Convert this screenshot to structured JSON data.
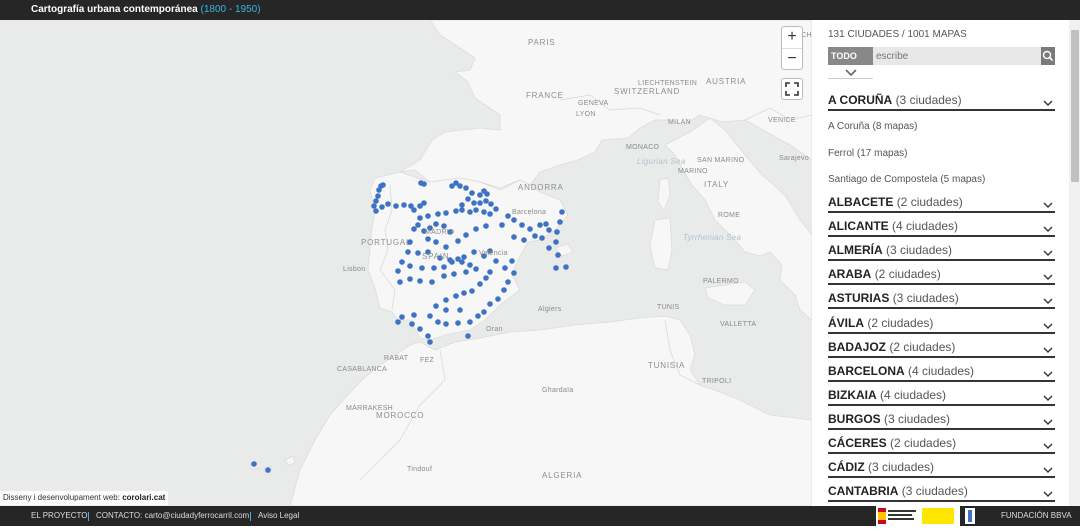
{
  "header": {
    "title": "Cartografía urbana contemporánea",
    "years": "(1800 - 1950)"
  },
  "map": {
    "controls": {
      "zoom_in": "+",
      "zoom_out": "−"
    },
    "credit_text": "Disseny i desenvolupament web:",
    "credit_link": "corolari.cat",
    "labels": {
      "paris": "PARIS",
      "munich": "MUNICH",
      "france": "FRANCE",
      "liechtenstein": "LIECHTENSTEIN",
      "austria": "AUSTRIA",
      "geneva": "GENEVA",
      "switzerland": "SWITZERLAND",
      "lyon": "LYON",
      "milan": "MILAN",
      "venice": "VENICE",
      "sanmarino": "SAN MARINO",
      "monaco": "MONACO",
      "ligurian": "Ligurian Sea",
      "italy": "ITALY",
      "andorra": "ANDORRA",
      "sarajevo": "Sarajevo",
      "rome": "ROME",
      "barcelona": "Barcelona",
      "madrid": "MADRID",
      "portugal": "PORTUGAL",
      "spain": "SPAIN",
      "tyrrhenian": "Tyrrhenian Sea",
      "valencia": "Valencia",
      "lisbon": "Lisbon",
      "palermo": "PALERMO",
      "algiers": "Algiers",
      "tunis": "TUNIS",
      "oran": "Oran",
      "valletta": "VALLETTA",
      "rabat": "RABAT",
      "fez": "FEZ",
      "casablanca": "CASABLANCA",
      "tunisia": "TUNISIA",
      "marrakesh": "MARRAKESH",
      "tripoli": "TRIPOLI",
      "morocco": "MOROCCO",
      "ghardaia": "Ghardaïa",
      "algeria": "ALGERIA",
      "tindouf": "Tindouf"
    },
    "city_points": 143
  },
  "panel": {
    "counts": "131 CIUDADES / 1001 MAPAS",
    "filter_all": "TODO",
    "search_placeholder": "escribe",
    "provinces": [
      {
        "name": "A CORUÑA",
        "count": "(3 ciudades)"
      },
      {
        "name": "ALBACETE",
        "count": "(2 ciudades)"
      },
      {
        "name": "ALICANTE",
        "count": "(4 ciudades)"
      },
      {
        "name": "ALMERÍA",
        "count": "(3 ciudades)"
      },
      {
        "name": "ARABA",
        "count": "(2 ciudades)"
      },
      {
        "name": "ASTURIAS",
        "count": "(3 ciudades)"
      },
      {
        "name": "ÁVILA",
        "count": "(2 ciudades)"
      },
      {
        "name": "BADAJOZ",
        "count": "(2 ciudades)"
      },
      {
        "name": "BARCELONA",
        "count": "(4 ciudades)"
      },
      {
        "name": "BIZKAIA",
        "count": "(4 ciudades)"
      },
      {
        "name": "BURGOS",
        "count": "(3 ciudades)"
      },
      {
        "name": "CÁCERES",
        "count": "(2 ciudades)"
      },
      {
        "name": "CÁDIZ",
        "count": "(3 ciudades)"
      },
      {
        "name": "CANTABRIA",
        "count": "(3 ciudades)"
      }
    ],
    "cities": [
      {
        "name": "A Coruña",
        "count": "(8 mapas)"
      },
      {
        "name": "Ferrol",
        "count": "(17 mapas)"
      },
      {
        "name": "Santiago de Compostela",
        "count": "(5 mapas)"
      }
    ]
  },
  "footer": {
    "proyecto": "EL PROYECTO",
    "contacto": "CONTACTO: carto@ciudadyferrocarril.com",
    "aviso": "Aviso Legal",
    "fundacion": "FUNDACIÓN BBVA"
  },
  "colors": {
    "accent": "#35b6e6",
    "point": "#3d72c4",
    "water": "#e9eaea",
    "land": "#f7f7f7"
  }
}
